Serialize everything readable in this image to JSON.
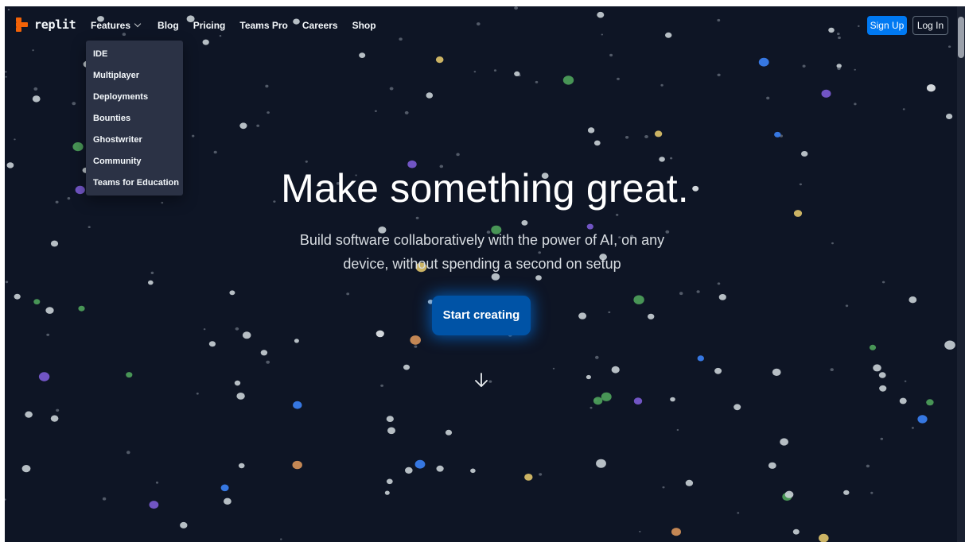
{
  "brand": {
    "name": "replit",
    "accent_color": "#f26207",
    "background_color": "#0e1525"
  },
  "nav": {
    "features_label": "Features",
    "items": [
      "Blog",
      "Pricing",
      "Teams Pro",
      "Careers",
      "Shop"
    ]
  },
  "features_menu": {
    "items": [
      "IDE",
      "Multiplayer",
      "Deployments",
      "Bounties",
      "Ghostwriter",
      "Community",
      "Teams for Education"
    ]
  },
  "auth": {
    "signup_label": "Sign Up",
    "login_label": "Log In",
    "primary_color": "#0079f2"
  },
  "hero": {
    "title": "Make something great.",
    "subtitle_line1": "Build software collaboratively with the power of AI, on any",
    "subtitle_line2": "device, without spending a second on setup",
    "cta_label": "Start creating",
    "scroll_icon": "arrow-down-icon"
  },
  "background": {
    "pattern": "scattered-dots",
    "dot_colors": [
      "#e8ecef",
      "#c9d0d6",
      "#e0c46c",
      "#d8935a",
      "#3b82f6",
      "#7c5cd6",
      "#4fa35c"
    ]
  }
}
